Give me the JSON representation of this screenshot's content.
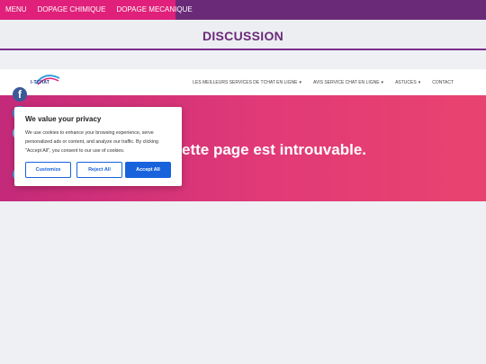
{
  "topbar": {
    "items": [
      "MENU",
      "DOPAGE CHIMIQUE",
      "DOPAGE MECANIQUE"
    ]
  },
  "banner": {
    "title": "DISCUSSION"
  },
  "header": {
    "logo_text": "I-TCHAT",
    "nav": [
      "LES MEILLEURS SERVICES DE TCHAT EN LIGNE",
      "AVIS SERVICE CHAT EN LIGNE",
      "ASTUCES",
      "CONTACT"
    ]
  },
  "hero": {
    "message": "ette page est introuvable."
  },
  "cookie": {
    "title": "We value your privacy",
    "body": "We use cookies to enhance your browsing experience, serve personalized ads or content, and analyze our traffic. By clicking \"Accept All\", you consent to our use of cookies.",
    "customize": "Customize",
    "reject": "Reject All",
    "accept": "Accept All"
  },
  "social": {
    "facebook_glyph": "f"
  },
  "colors": {
    "topbar": "#6a2a78",
    "menu_accent": "#e0207a",
    "hero_start": "#c42a7a",
    "hero_end": "#e8436f",
    "button_blue": "#1863dc"
  }
}
